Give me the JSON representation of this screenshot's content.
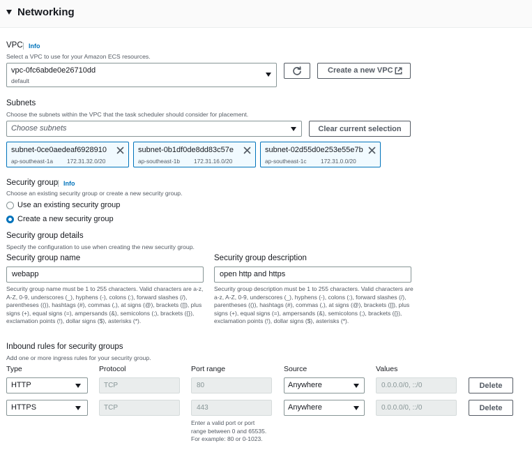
{
  "section": {
    "title": "Networking"
  },
  "vpc": {
    "label": "VPC",
    "info": "Info",
    "description": "Select a VPC to use for your Amazon ECS resources.",
    "selected_value": "vpc-0fc6abde0e26710dd",
    "selected_sub": "default",
    "create_button": "Create a new VPC"
  },
  "subnets": {
    "label": "Subnets",
    "description": "Choose the subnets within the VPC that the task scheduler should consider for placement.",
    "placeholder": "Choose subnets",
    "clear_button": "Clear current selection",
    "tokens": [
      {
        "name": "subnet-0ce0aedeaf6928910",
        "az": "ap-southeast-1a",
        "cidr": "172.31.32.0/20"
      },
      {
        "name": "subnet-0b1df0de8dd83c57e",
        "az": "ap-southeast-1b",
        "cidr": "172.31.16.0/20"
      },
      {
        "name": "subnet-02d55d0e253e55e7b",
        "az": "ap-southeast-1c",
        "cidr": "172.31.0.0/20"
      }
    ]
  },
  "security_group": {
    "label": "Security group",
    "info": "Info",
    "description": "Choose an existing security group or create a new security group.",
    "options": [
      {
        "label": "Use an existing security group",
        "selected": false
      },
      {
        "label": "Create a new security group",
        "selected": true
      }
    ]
  },
  "sg_details": {
    "title": "Security group details",
    "description": "Specify the configuration to use when creating the new security group.",
    "name_label": "Security group name",
    "name_value": "webapp",
    "name_help": "Security group name must be 1 to 255 characters. Valid characters are a-z, A-Z, 0-9, underscores (_), hyphens (-), colons (:), forward slashes (/), parentheses (()), hashtags (#), commas (,), at signs (@), brackets ([]), plus signs (+), equal signs (=), ampersands (&), semicolons (;), brackets ({}), exclamation points (!), dollar signs ($), asterisks (*).",
    "desc_label": "Security group description",
    "desc_value": "open http and https",
    "desc_help": "Security group description must be 1 to 255 characters. Valid characters are a-z, A-Z, 0-9, underscores (_), hyphens (-), colons (:), forward slashes (/), parentheses (()), hashtags (#), commas (,), at signs (@), brackets ([]), plus signs (+), equal signs (=), ampersands (&), semicolons (;), brackets ({}), exclamation points (!), dollar signs ($), asterisks (*)."
  },
  "inbound": {
    "title": "Inbound rules for security groups",
    "description": "Add one or more ingress rules for your security group.",
    "columns": {
      "type": "Type",
      "protocol": "Protocol",
      "port": "Port range",
      "source": "Source",
      "values": "Values"
    },
    "rows": [
      {
        "type": "HTTP",
        "protocol": "TCP",
        "port": "80",
        "source": "Anywhere",
        "values": "0.0.0.0/0, ::/0",
        "delete": "Delete"
      },
      {
        "type": "HTTPS",
        "protocol": "TCP",
        "port": "443",
        "source": "Anywhere",
        "values": "0.0.0.0/0, ::/0",
        "delete": "Delete"
      }
    ],
    "port_help": "Enter a valid port or port range between 0 and 65535. For example: 80 or 0-1023."
  },
  "colors": {
    "accent": "#0073bb",
    "token_bg": "#f1faff",
    "text": "#16191f",
    "muted": "#545b64",
    "border": "#879596"
  },
  "icons": {
    "expand": "caret-down-icon",
    "refresh": "refresh-icon",
    "external": "external-link-icon",
    "dismiss": "close-icon",
    "dropdown": "chevron-down-icon"
  }
}
